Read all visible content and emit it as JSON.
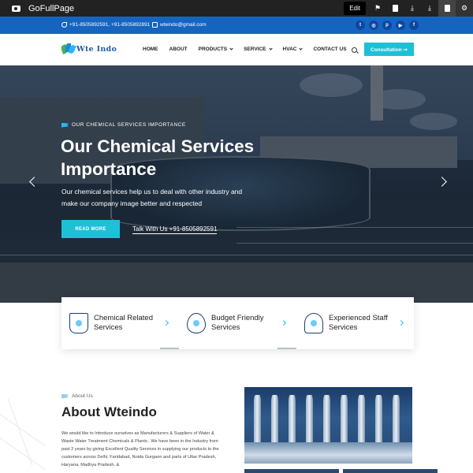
{
  "extension_bar": {
    "brand": "GoFullPage",
    "edit_label": "Edit"
  },
  "topbar": {
    "phones": "+91-8505892591, +91-8505892891",
    "email": "wteindo@gmail.com",
    "socials": [
      "twitter-icon",
      "instagram-icon",
      "pinterest-icon",
      "youtube-icon",
      "facebook-icon"
    ]
  },
  "nav": {
    "logo_text": "Wte Indo",
    "links": [
      {
        "label": "HOME",
        "dropdown": false
      },
      {
        "label": "ABOUT",
        "dropdown": false
      },
      {
        "label": "PRODUCTS",
        "dropdown": true
      },
      {
        "label": "SERVICE",
        "dropdown": true
      },
      {
        "label": "HVAC",
        "dropdown": true
      },
      {
        "label": "CONTACT US",
        "dropdown": false
      }
    ],
    "cta": "Consultation ➞"
  },
  "hero": {
    "eyebrow": "OUR CHEMICAL SERVICES IMPORTANCE",
    "title": "Our Chemical Services Importance",
    "description": "Our chemical services help us to deal with other industry and make our company image better and respected",
    "primary_button": "READ MORE",
    "secondary_link": "Talk With Us +91-8505892591"
  },
  "services": [
    {
      "title": "Chemical Related Services",
      "icon": "flask-icon"
    },
    {
      "title": "Budget Friendly Services",
      "icon": "money-drop-icon"
    },
    {
      "title": "Experienced Staff Services",
      "icon": "engineer-icon"
    }
  ],
  "about": {
    "eyebrow": "About Us",
    "title": "About Wteindo",
    "body": "We would like to Introduce ourselves as Manufacturers & Suppliers of Water & Waste Water Treatment Chemicals & Plants.. We have been in the Industry from past 2 years by giving Excellent Quality Services in supplying our products to the customers across Delhi, Faridabad, Noida Gurgaon and parts of Uttar Pradesh, Haryana, Madhya Pradesh, &"
  },
  "colors": {
    "topbar": "#1565c0",
    "accent": "#1ec0d8",
    "logo": "#1e5aa8"
  }
}
